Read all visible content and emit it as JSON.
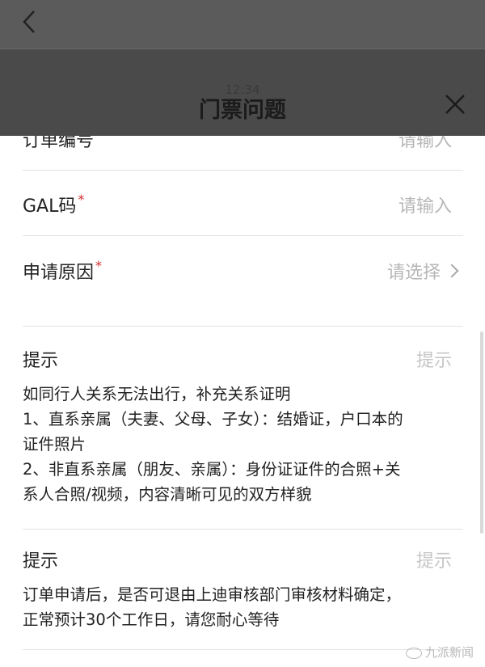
{
  "status_bar": {
    "time": "12:34"
  },
  "sheet": {
    "title": "门票问题"
  },
  "fields": [
    {
      "label": "订单编号",
      "required": "",
      "placeholder": "请输入"
    },
    {
      "label": "GAL码",
      "required": "*",
      "placeholder": "请输入"
    },
    {
      "label": "申请原因",
      "required": "*",
      "placeholder": "请选择"
    }
  ],
  "tips": [
    {
      "title": "提示",
      "badge": "提示",
      "lines": [
        "如同行人关系无法出行，补充关系证明",
        "1、直系亲属（夫妻、父母、子女）：结婚证，户口本的",
        "证件照片",
        "2、非直系亲属（朋友、亲属）：身份证证件的合照+关",
        "系人合照/视频，内容清晰可见的双方样貌"
      ]
    },
    {
      "title": "提示",
      "badge": "提示",
      "lines": [
        "订单申请后，是否可退由上迪审核部门审核材料确定，",
        "正常预计30个工作日，请您耐心等待"
      ]
    }
  ],
  "watermark": {
    "text": "九派新闻"
  },
  "icons": {
    "back": "chevron-left-icon",
    "close": "close-icon",
    "select": "chevron-right-icon"
  }
}
